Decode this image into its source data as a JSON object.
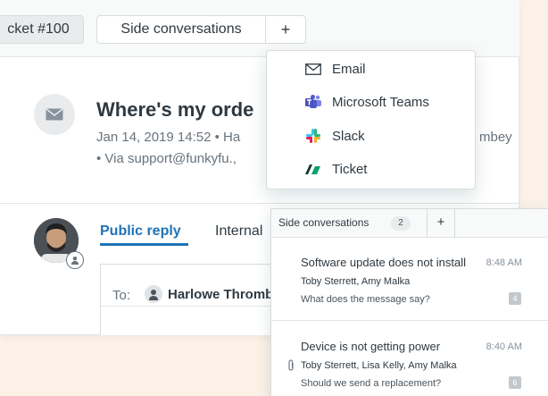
{
  "tabs": {
    "ticket_label": "cket #100",
    "side_label": "Side conversations",
    "plus_label": "+"
  },
  "ticket": {
    "subject": "Where's my orde",
    "meta_line1": "Jan 14, 2019 14:52 • Ha",
    "meta_line1_tail": "mbey",
    "meta_line2": "• Via support@funkyfu.,"
  },
  "reply": {
    "public_label": "Public reply",
    "internal_label": "Internal",
    "to_label": "To:",
    "to_recipient": "Harlowe Thromb"
  },
  "dropdown": {
    "items": [
      {
        "label": "Email",
        "icon": "envelope-icon"
      },
      {
        "label": "Microsoft Teams",
        "icon": "microsoft-teams-icon"
      },
      {
        "label": "Slack",
        "icon": "slack-icon"
      },
      {
        "label": "Ticket",
        "icon": "ticket-icon"
      }
    ]
  },
  "side_panel": {
    "title": "Side conversations",
    "count": "2",
    "plus_label": "+",
    "conversations": [
      {
        "title": "Software update does not install",
        "time": "8:48 AM",
        "people": "Toby Sterrett, Amy Malka",
        "message": "What does the message say?",
        "badge": "4",
        "has_attachment": false
      },
      {
        "title": "Device is not getting power",
        "time": "8:40 AM",
        "people": "Toby Sterrett, Lisa Kelly, Amy Malka",
        "message": "Should we send a replacement?",
        "badge": "6",
        "has_attachment": true
      }
    ]
  },
  "colors": {
    "background": "#fbf1e7",
    "accent": "#1f73b7",
    "text": "#2f3941",
    "muted": "#68737d"
  }
}
